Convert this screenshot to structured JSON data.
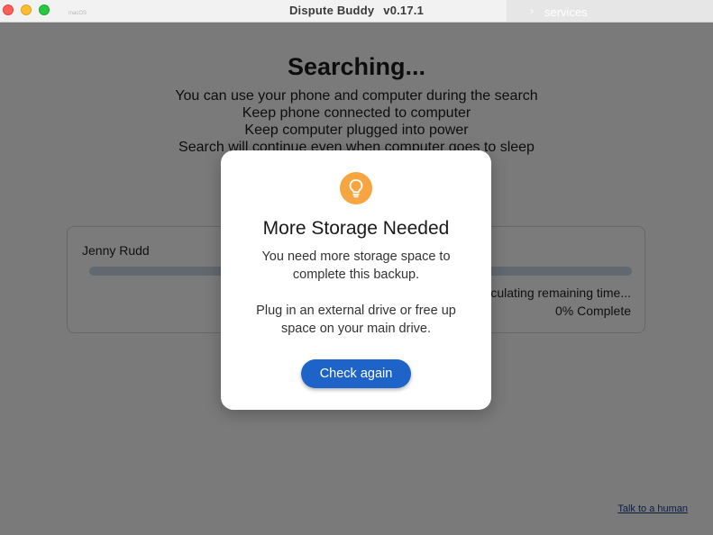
{
  "window": {
    "os_label": "macOS",
    "app_name": "Dispute Buddy",
    "version": "v0.17.1",
    "services_tab": {
      "label": "services",
      "chevron": "›"
    }
  },
  "search": {
    "heading": "Searching...",
    "instructions": [
      "You can use your phone and computer during the search",
      "Keep phone connected to computer",
      "Keep computer plugged into power",
      "Search will continue even when computer goes to sleep"
    ]
  },
  "device": {
    "name": "Jenny Rudd",
    "remaining_text": "Calculating remaining time...",
    "progress_percent": 0,
    "complete_text": "0% Complete"
  },
  "footer": {
    "talk_link": "Talk to a human"
  },
  "modal": {
    "icon": "lightbulb-icon",
    "icon_color": "#f7a540",
    "title": "More Storage Needed",
    "text1": "You need more storage space to complete this backup.",
    "text2": "Plug in an external drive or free up space on your main drive.",
    "button": "Check again",
    "button_color": "#1e63c8"
  }
}
